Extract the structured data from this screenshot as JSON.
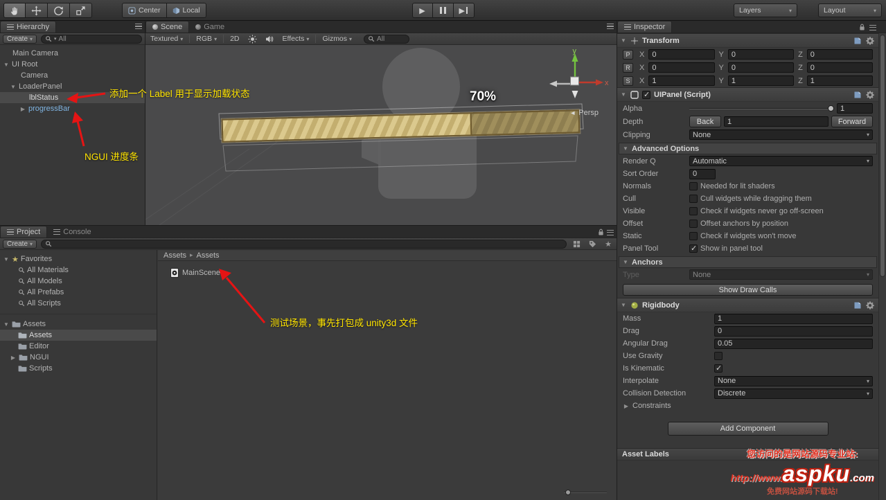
{
  "icons": {
    "caret": "▾",
    "open": "▼",
    "closed": "▶",
    "play": "▶",
    "star": "★",
    "check": "✓",
    "crumb": "▸",
    "persp": "◄"
  },
  "toolbar": {
    "center": "Center",
    "local": "Local",
    "layers": "Layers",
    "layout": "Layout"
  },
  "hierarchy": {
    "tab": "Hierarchy",
    "create": "Create",
    "search_all": "All",
    "items": [
      {
        "label": "Main Camera"
      },
      {
        "label": "UI Root"
      },
      {
        "label": "Camera"
      },
      {
        "label": "LoaderPanel"
      },
      {
        "label": "lblStatus"
      },
      {
        "label": "progressBar"
      }
    ],
    "annotation_label": "添加一个 Label 用于显示加载状态",
    "annotation_progressbar": "NGUI 进度条"
  },
  "scene": {
    "tab_scene": "Scene",
    "tab_game": "Game",
    "textured": "Textured",
    "rgb": "RGB",
    "mode_2d": "2D",
    "effects": "Effects",
    "gizmos": "Gizmos",
    "search_all": "All",
    "progress_value": "70%",
    "persp": "Persp",
    "axis_x": "x",
    "axis_y": "y"
  },
  "project": {
    "tab_project": "Project",
    "tab_console": "Console",
    "create": "Create",
    "search_all": "",
    "favorites": "Favorites",
    "fav_items": [
      "All Materials",
      "All Models",
      "All Prefabs",
      "All Scripts"
    ],
    "assets_root": "Assets",
    "folders": [
      "Assets",
      "Editor",
      "NGUI",
      "Scripts"
    ],
    "breadcrumb": [
      "Assets",
      "Assets"
    ],
    "scene_file": "MainScene",
    "annotation": "测试场景，事先打包成 unity3d 文件"
  },
  "inspector": {
    "tab": "Inspector",
    "transform": {
      "title": "Transform",
      "ax": "X",
      "ay": "Y",
      "az": "Z",
      "rows": [
        {
          "key": "P",
          "x": "0",
          "y": "0",
          "z": "0"
        },
        {
          "key": "R",
          "x": "0",
          "y": "0",
          "z": "0"
        },
        {
          "key": "S",
          "x": "1",
          "y": "1",
          "z": "1"
        }
      ]
    },
    "uipanel": {
      "title": "UIPanel (Script)",
      "enabled": true,
      "alpha": "Alpha",
      "alpha_value": "1",
      "depth": "Depth",
      "back": "Back",
      "depth_value": "1",
      "forward": "Forward",
      "clipping": "Clipping",
      "clipping_value": "None",
      "advanced": "Advanced Options",
      "render_q": "Render Q",
      "render_q_value": "Automatic",
      "sort_order": "Sort Order",
      "sort_order_value": "0",
      "options": [
        {
          "label": "Normals",
          "desc": "Needed for lit shaders",
          "checked": false
        },
        {
          "label": "Cull",
          "desc": "Cull widgets while dragging them",
          "checked": false
        },
        {
          "label": "Visible",
          "desc": "Check if widgets never go off-screen",
          "checked": false
        },
        {
          "label": "Offset",
          "desc": "Offset anchors by position",
          "checked": false
        },
        {
          "label": "Static",
          "desc": "Check if widgets won't move",
          "checked": false
        },
        {
          "label": "Panel Tool",
          "desc": "Show in panel tool",
          "checked": true
        }
      ],
      "anchors": "Anchors",
      "type": "Type",
      "type_value": "None",
      "show_draw_calls": "Show Draw Calls"
    },
    "rigidbody": {
      "title": "Rigidbody",
      "mass": "Mass",
      "mass_value": "1",
      "drag": "Drag",
      "drag_value": "0",
      "angular_drag": "Angular Drag",
      "angular_drag_value": "0.05",
      "use_gravity": "Use Gravity",
      "use_gravity_checked": false,
      "is_kinematic": "Is Kinematic",
      "is_kinematic_checked": true,
      "interpolate": "Interpolate",
      "interpolate_value": "None",
      "collision": "Collision Detection",
      "collision_value": "Discrete",
      "constraints": "Constraints"
    },
    "add_component": "Add Component",
    "asset_labels": "Asset Labels"
  },
  "watermark": {
    "line1": "您访问的是网站源码专业站:",
    "prefix": "http://www.",
    "logo": "aspku",
    "suffix": ".com",
    "line2": "免费网站源码下载站!"
  }
}
